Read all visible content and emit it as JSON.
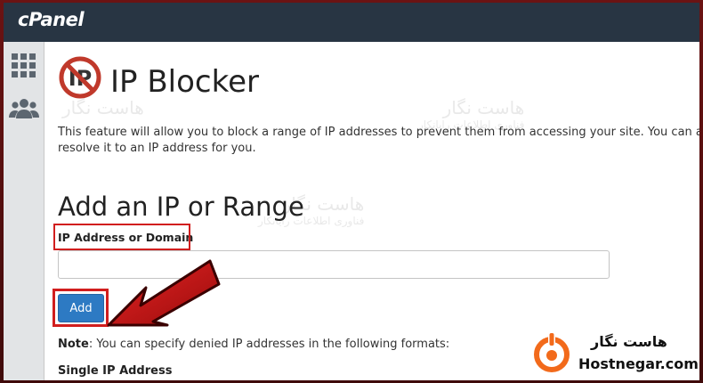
{
  "app": {
    "logo_text": "cPanel"
  },
  "sidebar": {
    "items": [
      {
        "icon": "grid-icon"
      },
      {
        "icon": "users-icon"
      }
    ]
  },
  "page": {
    "title": "IP Blocker",
    "intro_line1": "This feature will allow you to block a range of IP addresses to prevent them from accessing your site. You can al",
    "intro_line2": "resolve it to an IP address for you."
  },
  "form": {
    "section_title": "Add an IP or Range",
    "field_label": "IP Address or Domain",
    "field_value": "",
    "field_placeholder": "",
    "add_button_label": "Add"
  },
  "note": {
    "label": "Note",
    "text": ": You can specify denied IP addresses in the following formats:",
    "subheading": "Single IP Address"
  },
  "watermark": {
    "name": "هاست نگار",
    "subtitle": "فناوری اطلاعات رایانکار"
  },
  "brand": {
    "name_fa": "هاست نگار",
    "name_en": "Hostnegar.com",
    "accent": "#f26a1b"
  },
  "colors": {
    "topbar": "#283543",
    "button": "#2d7ac3",
    "highlight": "#d11e1e",
    "arrow": "#c21515"
  }
}
